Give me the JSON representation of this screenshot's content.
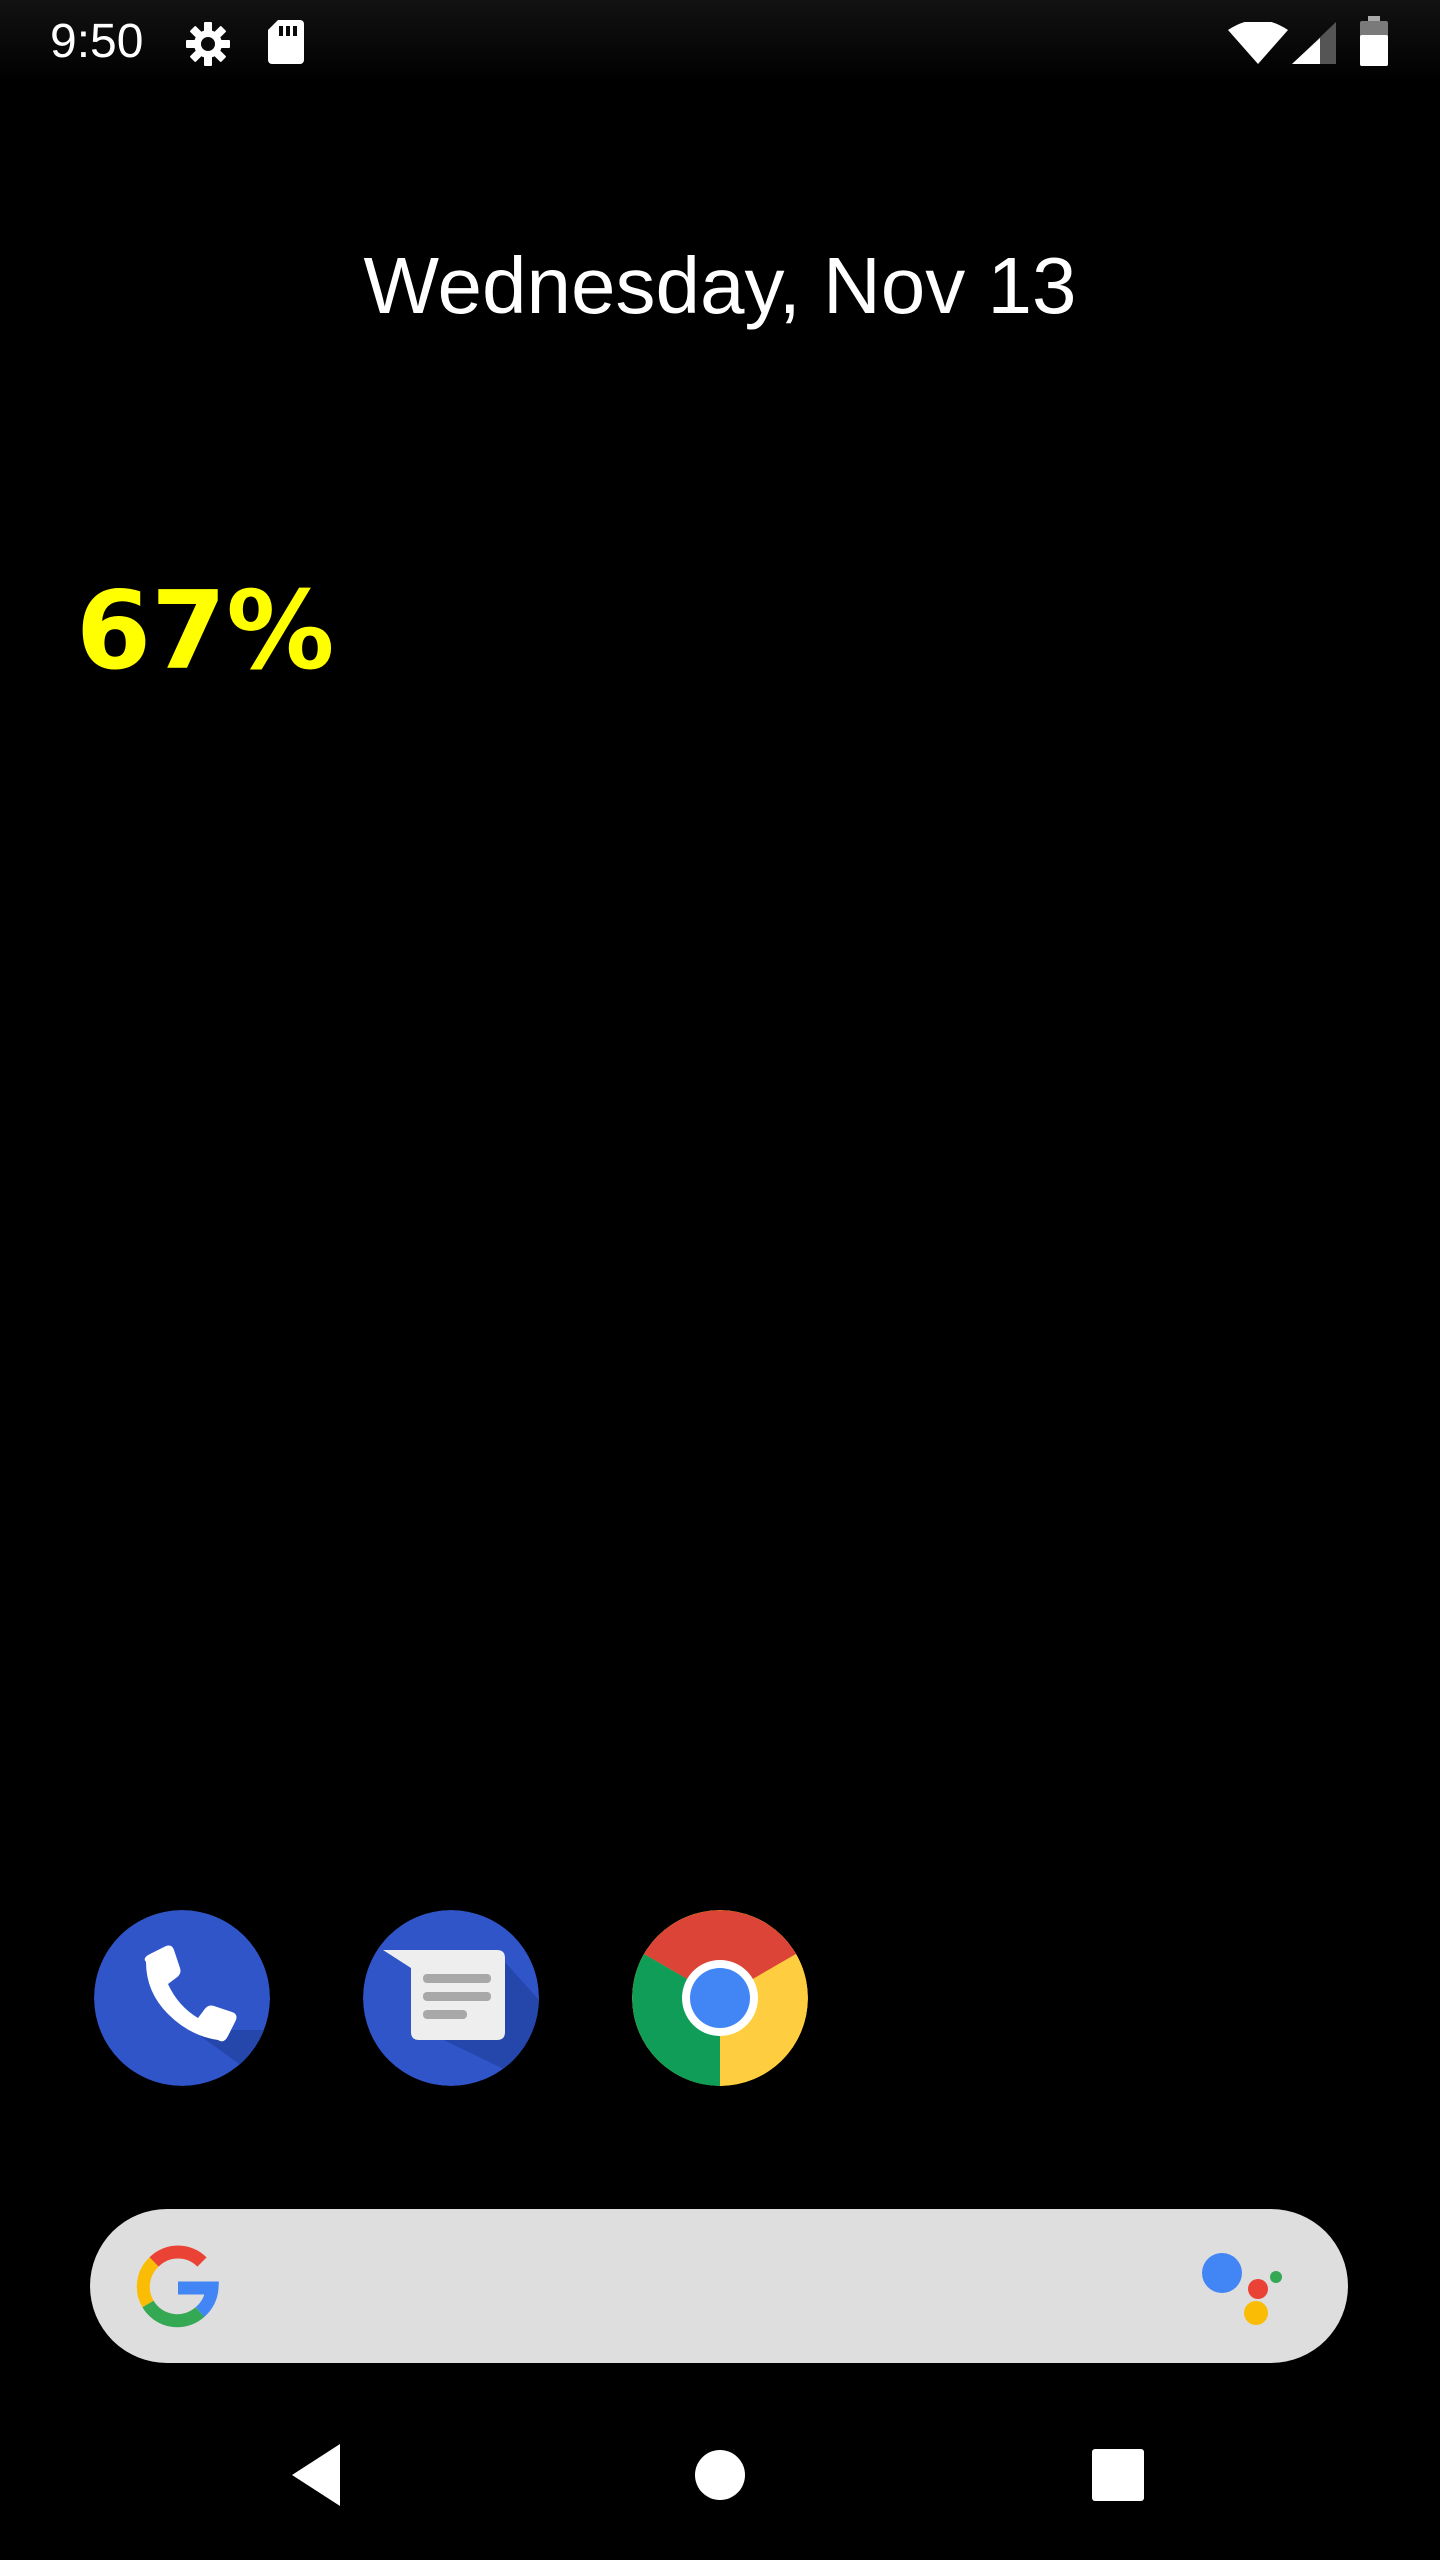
{
  "status_bar": {
    "time": "9:50",
    "left_icons": [
      "gear-icon",
      "sd-card-icon"
    ],
    "right_icons": [
      "wifi-icon",
      "signal-icon",
      "battery-icon"
    ]
  },
  "home": {
    "date": "Wednesday, Nov 13",
    "battery_widget": {
      "text": "67%",
      "color": "#ffff00"
    }
  },
  "dock": {
    "apps": [
      {
        "name": "Phone",
        "icon": "phone-icon"
      },
      {
        "name": "Messages",
        "icon": "messages-icon"
      },
      {
        "name": "Chrome",
        "icon": "chrome-icon"
      }
    ]
  },
  "search_bar": {
    "left_icon": "google-g-icon",
    "right_icon": "google-assistant-icon"
  },
  "nav_bar": {
    "buttons": [
      "back-icon",
      "home-icon",
      "recents-icon"
    ]
  },
  "colors": {
    "background": "#000000",
    "widget_accent": "#ffff00",
    "search_bar_bg": "#dedede",
    "dock_blue": "#2f55c8"
  }
}
